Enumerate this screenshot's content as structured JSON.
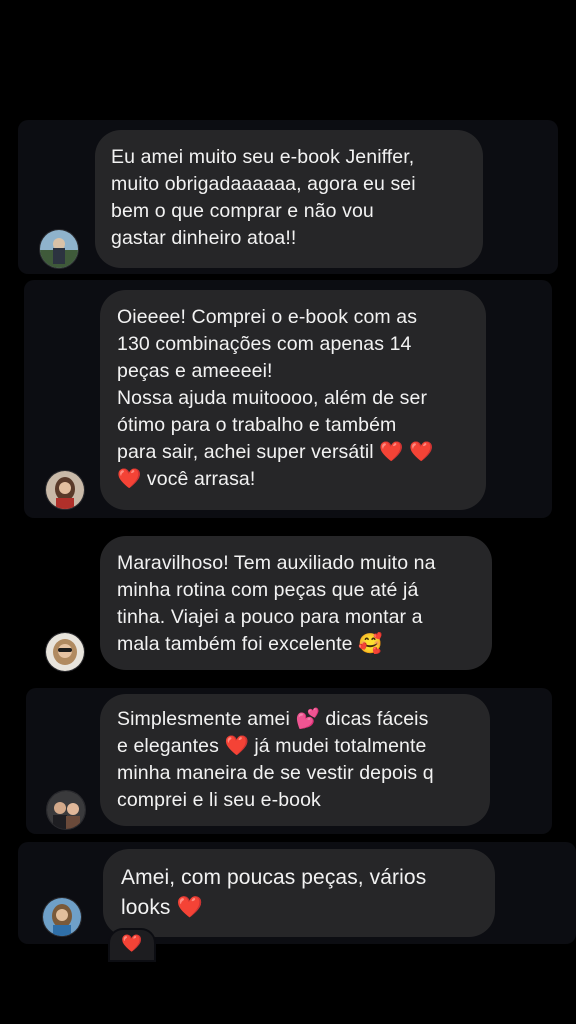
{
  "messages": [
    {
      "text": "Eu amei muito seu e-book Jeniffer,\nmuito obrigadaaaaaa, agora eu sei\nbem o que comprar e não vou\ngastar dinheiro atoa!!",
      "avatar": "avatar-woman-landscape"
    },
    {
      "text": "Oieeee! Comprei o e-book com as\n130 combinações com apenas 14\npeças e ameeeei!\nNossa ajuda muitoooo, além de ser\nótimo para o trabalho e também\npara sair, achei super versátil ❤️ ❤️\n❤️ você arrasa!",
      "avatar": "avatar-woman-red"
    },
    {
      "text": "Maravilhoso! Tem auxiliado muito na\nminha rotina com peças que até já\ntinha. Viajei a pouco para montar a\nmala também foi excelente 🥰",
      "avatar": "avatar-woman-sunglasses"
    },
    {
      "text": "Simplesmente amei 💕  dicas fáceis\ne elegantes ❤️  já mudei totalmente\nminha maneira de se vestir depois q\ncomprei e li seu e-book",
      "avatar": "avatar-couple"
    },
    {
      "text": "Amei, com poucas peças, vários\nlooks ❤️",
      "avatar": "avatar-woman-blue",
      "reaction": "❤️"
    }
  ],
  "colors": {
    "background": "#000000",
    "card": "#0c0d12",
    "bubble": "#262628",
    "text": "#f2f2f2"
  }
}
